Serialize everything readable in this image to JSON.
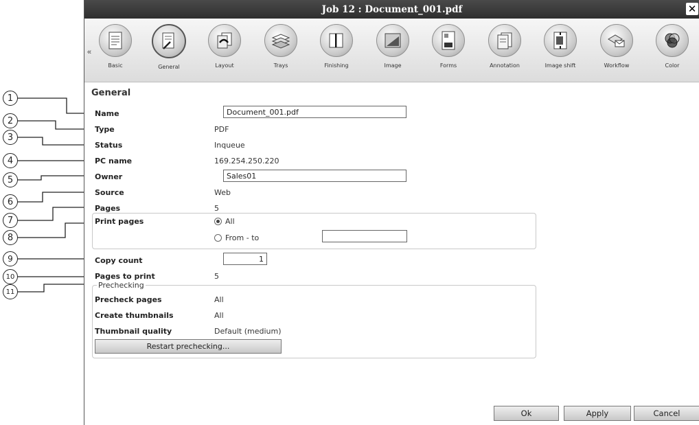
{
  "window": {
    "title": "Job 12 : Document_001.pdf",
    "close_glyph": "✕"
  },
  "toolbar": {
    "prev_glyph": "«",
    "items": [
      {
        "label": "Basic",
        "icon": "document-icon"
      },
      {
        "label": "General",
        "icon": "document-pen-icon",
        "active": true
      },
      {
        "label": "Layout",
        "icon": "layout-icon"
      },
      {
        "label": "Trays",
        "icon": "trays-icon"
      },
      {
        "label": "Finishing",
        "icon": "finishing-icon"
      },
      {
        "label": "Image",
        "icon": "image-icon"
      },
      {
        "label": "Forms",
        "icon": "forms-icon"
      },
      {
        "label": "Annotation",
        "icon": "annotation-icon"
      },
      {
        "label": "Image shift",
        "icon": "image-shift-icon"
      },
      {
        "label": "Workflow",
        "icon": "workflow-icon"
      },
      {
        "label": "Color",
        "icon": "color-icon"
      }
    ]
  },
  "section_title": "General",
  "fields": {
    "name": {
      "label": "Name",
      "value": "Document_001.pdf"
    },
    "type": {
      "label": "Type",
      "value": "PDF"
    },
    "status": {
      "label": "Status",
      "value": "Inqueue"
    },
    "pc_name": {
      "label": "PC name",
      "value": "169.254.250.220"
    },
    "owner": {
      "label": "Owner",
      "value": "Sales01"
    },
    "source": {
      "label": "Source",
      "value": "Web"
    },
    "pages": {
      "label": "Pages",
      "value": "5"
    },
    "print_pages": {
      "label": "Print pages",
      "option_all": "All",
      "option_range": "From - to",
      "range_value": "",
      "selected": "All"
    },
    "copy_count": {
      "label": "Copy count",
      "value": "1"
    },
    "pages_to_print": {
      "label": "Pages to print",
      "value": "5"
    }
  },
  "prechecking": {
    "legend": "Prechecking",
    "precheck_pages": {
      "label": "Precheck pages",
      "value": "All"
    },
    "create_thumbnails": {
      "label": "Create thumbnails",
      "value": "All"
    },
    "thumbnail_quality": {
      "label": "Thumbnail quality",
      "value": "Default (medium)"
    },
    "restart_button": "Restart prechecking..."
  },
  "buttons": {
    "ok": "Ok",
    "apply": "Apply",
    "cancel": "Cancel"
  },
  "callouts": [
    "1",
    "2",
    "3",
    "4",
    "5",
    "6",
    "7",
    "8",
    "9",
    "10",
    "11"
  ],
  "colors": {
    "titlebar": "#3a3a3a",
    "toolbar": "#e6e6e6",
    "border": "#c8c8c8"
  }
}
